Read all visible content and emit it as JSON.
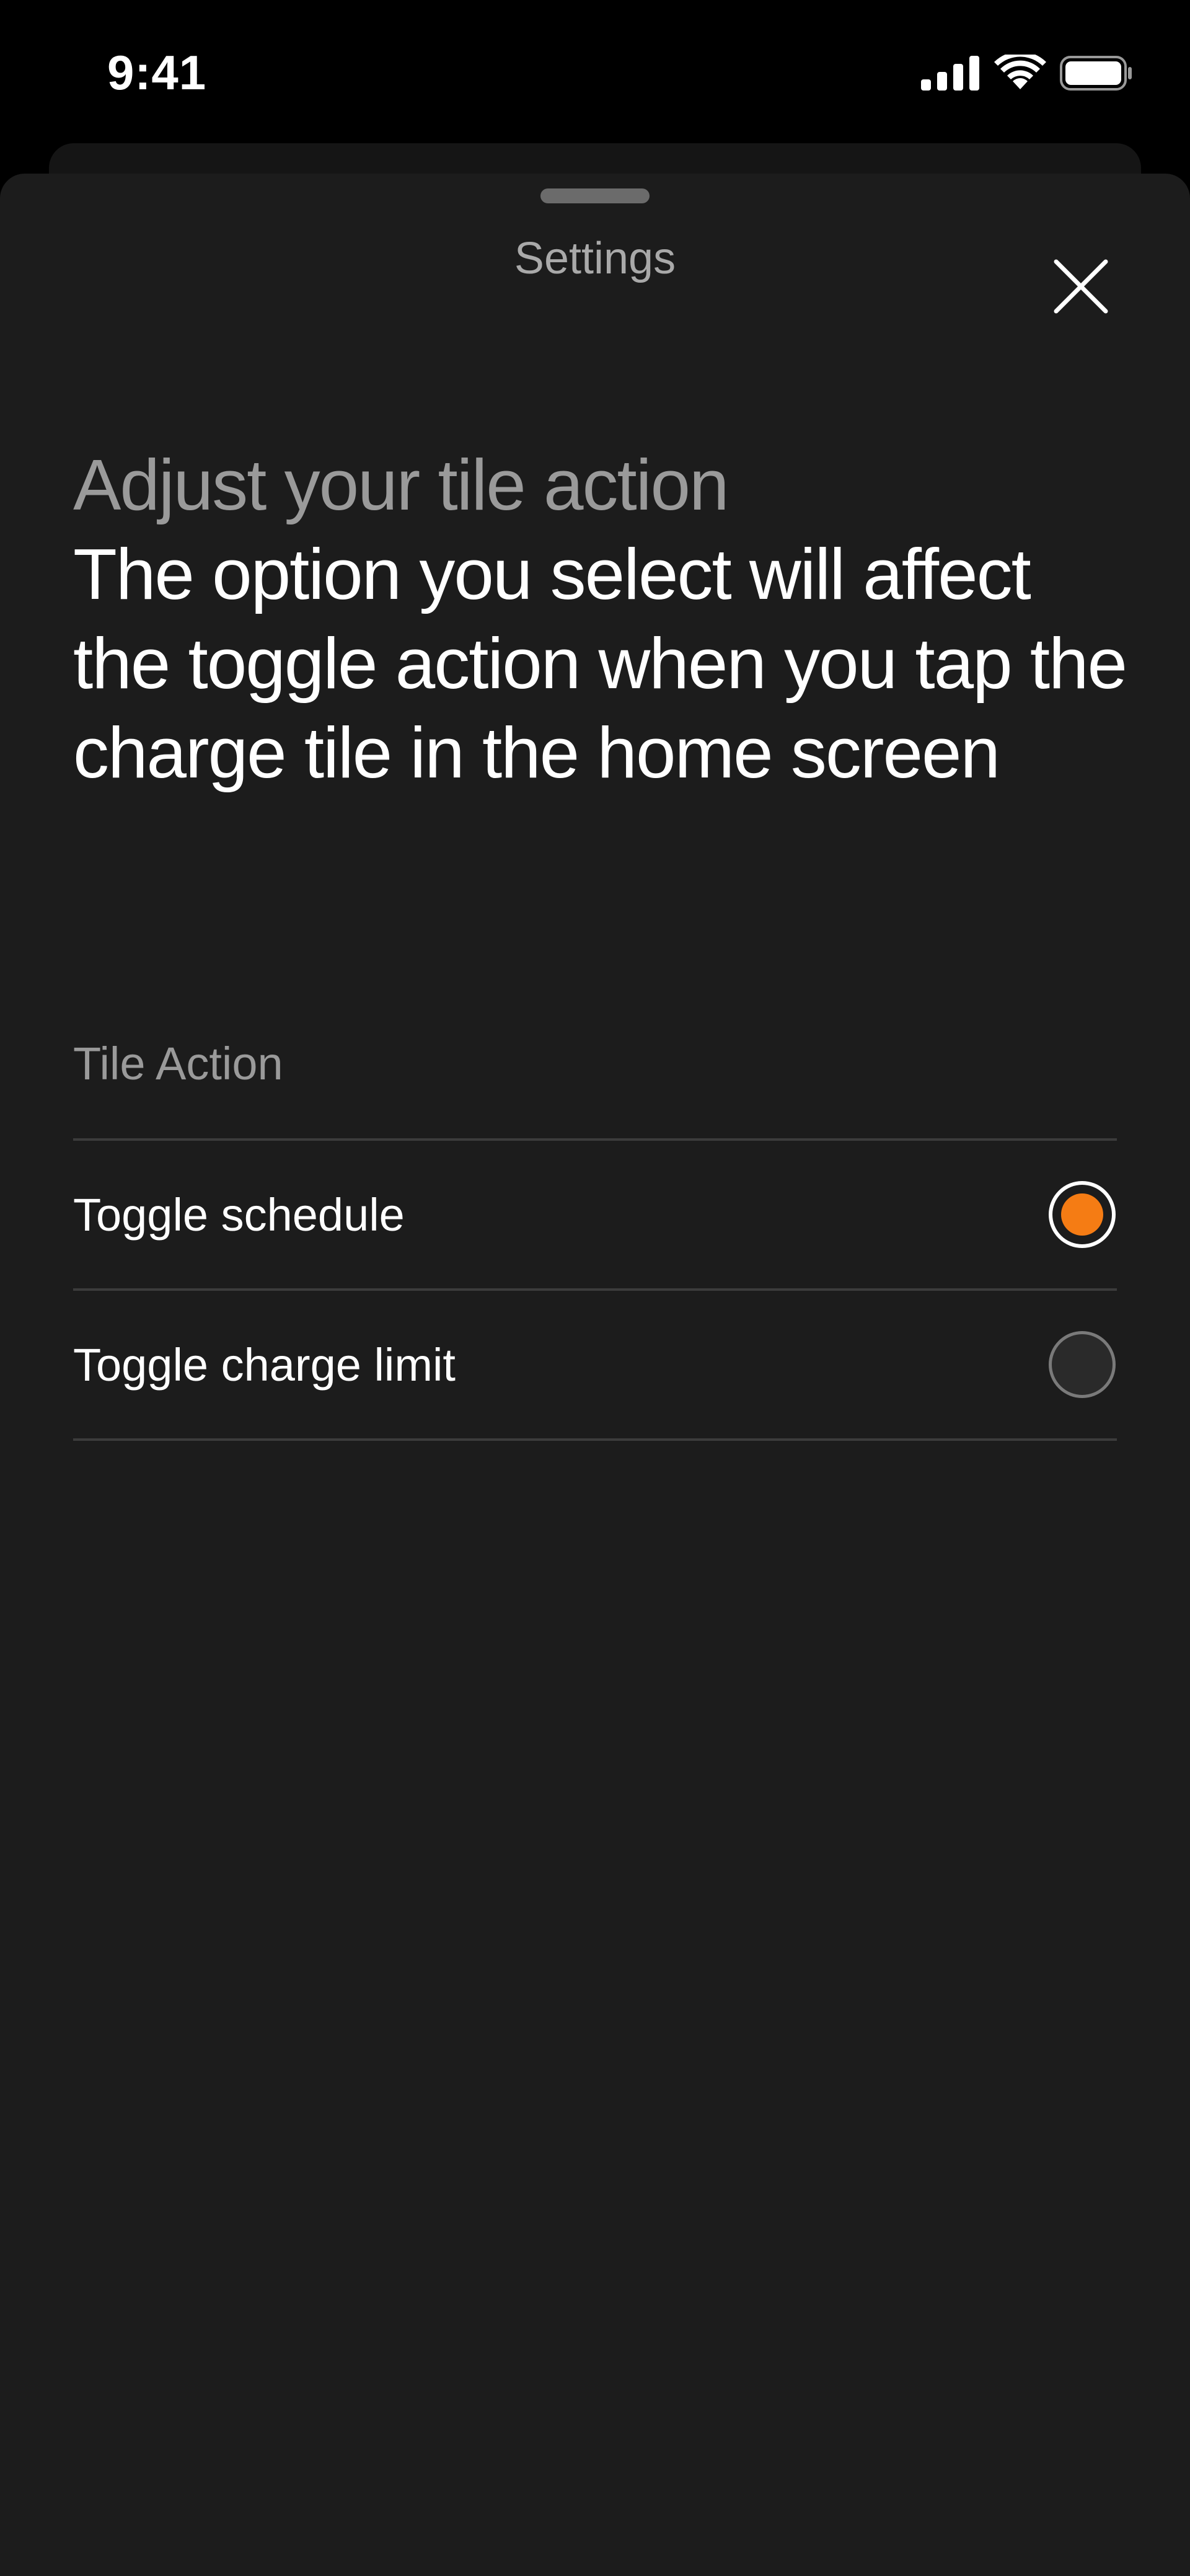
{
  "status_bar": {
    "time": "9:41",
    "icons": [
      "cellular-signal-icon",
      "wifi-icon",
      "battery-icon"
    ]
  },
  "sheet": {
    "title": "Settings",
    "close_icon": "close-icon"
  },
  "intro": {
    "heading": "Adjust your tile action",
    "body": "The option you select will affect the toggle action when you tap the charge tile in the home screen"
  },
  "tile_action": {
    "section_label": "Tile Action",
    "options": [
      {
        "label": "Toggle schedule",
        "selected": true
      },
      {
        "label": "Toggle charge limit",
        "selected": false
      }
    ]
  },
  "colors": {
    "accent": "#f57c14",
    "sheet_background": "#1c1c1c",
    "secondary_text": "#9a9a9a"
  }
}
